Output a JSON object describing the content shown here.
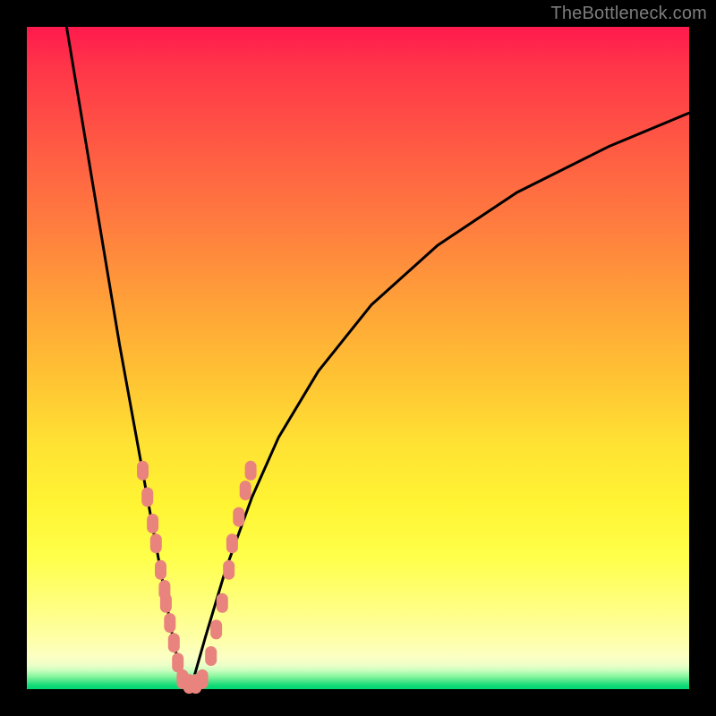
{
  "watermark": "TheBottleneck.com",
  "colors": {
    "curve": "#000000",
    "marker_fill": "#e9837d",
    "marker_stroke": "#e9837d",
    "frame": "#000000"
  },
  "chart_data": {
    "type": "line",
    "title": "",
    "xlabel": "",
    "ylabel": "",
    "xlim": [
      0,
      100
    ],
    "ylim": [
      0,
      100
    ],
    "note": "Two-branch bottleneck curve; y is mismatch %, minimum ~0 near x≈24. Values estimated from pixels.",
    "series": [
      {
        "name": "left-branch",
        "x": [
          6,
          8,
          10,
          12,
          14,
          16,
          18,
          20,
          22,
          23.5
        ],
        "y": [
          100,
          88,
          76,
          64,
          52,
          41,
          30,
          19,
          8,
          1
        ]
      },
      {
        "name": "right-branch",
        "x": [
          25,
          27,
          30,
          34,
          38,
          44,
          52,
          62,
          74,
          88,
          100
        ],
        "y": [
          1,
          8,
          18,
          29,
          38,
          48,
          58,
          67,
          75,
          82,
          87
        ]
      }
    ],
    "markers": {
      "name": "datapoints",
      "note": "salmon rounded markers clustered near the valley on both branches",
      "points": [
        {
          "x": 17.5,
          "y": 33
        },
        {
          "x": 18.2,
          "y": 29
        },
        {
          "x": 19.0,
          "y": 25
        },
        {
          "x": 19.5,
          "y": 22
        },
        {
          "x": 20.2,
          "y": 18
        },
        {
          "x": 20.8,
          "y": 15
        },
        {
          "x": 21.0,
          "y": 13
        },
        {
          "x": 21.6,
          "y": 10
        },
        {
          "x": 22.2,
          "y": 7
        },
        {
          "x": 22.8,
          "y": 4
        },
        {
          "x": 23.5,
          "y": 1.5
        },
        {
          "x": 24.5,
          "y": 0.8
        },
        {
          "x": 25.5,
          "y": 0.8
        },
        {
          "x": 26.5,
          "y": 1.5
        },
        {
          "x": 27.8,
          "y": 5
        },
        {
          "x": 28.6,
          "y": 9
        },
        {
          "x": 29.5,
          "y": 13
        },
        {
          "x": 30.5,
          "y": 18
        },
        {
          "x": 31.0,
          "y": 22
        },
        {
          "x": 32.0,
          "y": 26
        },
        {
          "x": 33.0,
          "y": 30
        },
        {
          "x": 33.8,
          "y": 33
        }
      ]
    }
  }
}
